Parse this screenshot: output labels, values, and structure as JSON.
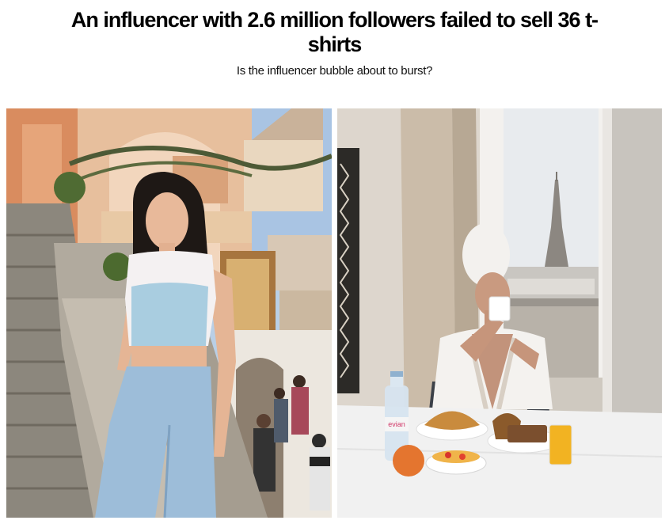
{
  "article": {
    "headline": "An influencer with 2.6 million followers failed to sell 36 t-shirts",
    "subheadline": "Is the influencer bubble about to burst?"
  },
  "photos": [
    {
      "name": "influencer-stairs-photo"
    },
    {
      "name": "influencer-breakfast-photo",
      "bottle_label": "evian"
    }
  ],
  "colors": {
    "headline": "#000000",
    "background": "#ffffff"
  }
}
